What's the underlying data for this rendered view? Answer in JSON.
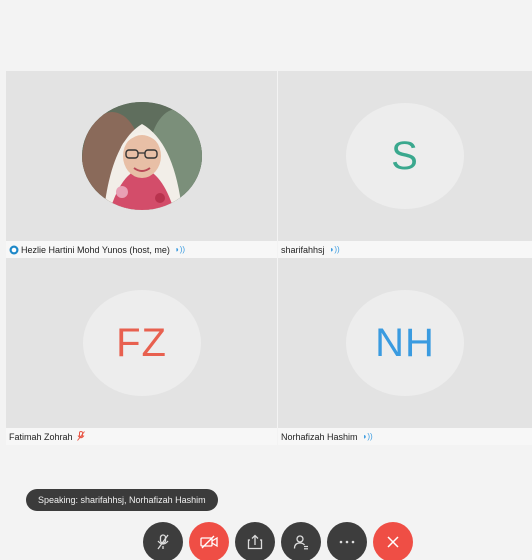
{
  "participants": [
    {
      "name": "Hezlie Hartini  Mohd Yunos  (host, me)",
      "avatar_type": "photo",
      "audio": "speaking-icon"
    },
    {
      "name": "sharifahhsj",
      "initials": "S",
      "initials_color": "#3aa88e",
      "audio": "speaking-icon"
    },
    {
      "name": "Fatimah Zohrah",
      "initials": "FZ",
      "initials_color": "#e8604f",
      "audio": "muted-mic-icon"
    },
    {
      "name": "Norhafizah Hashim",
      "initials": "NH",
      "initials_color": "#3a9be0",
      "audio": "speaking-icon"
    }
  ],
  "speaking_banner": "Speaking: sharifahhsj, Norhafizah Hashim",
  "controls": [
    {
      "icon": "mute-mic-icon",
      "color": "#3d3d3d"
    },
    {
      "icon": "stop-video-icon",
      "color": "#ef4e45"
    },
    {
      "icon": "share-icon",
      "color": "#3d3d3d"
    },
    {
      "icon": "participants-icon",
      "color": "#3d3d3d"
    },
    {
      "icon": "more-icon",
      "color": "#3d3d3d"
    },
    {
      "icon": "leave-icon",
      "color": "#ef4e45"
    }
  ],
  "colors": {
    "active_border": "#4aa3d8",
    "accent_blue": "#3a9be0"
  }
}
